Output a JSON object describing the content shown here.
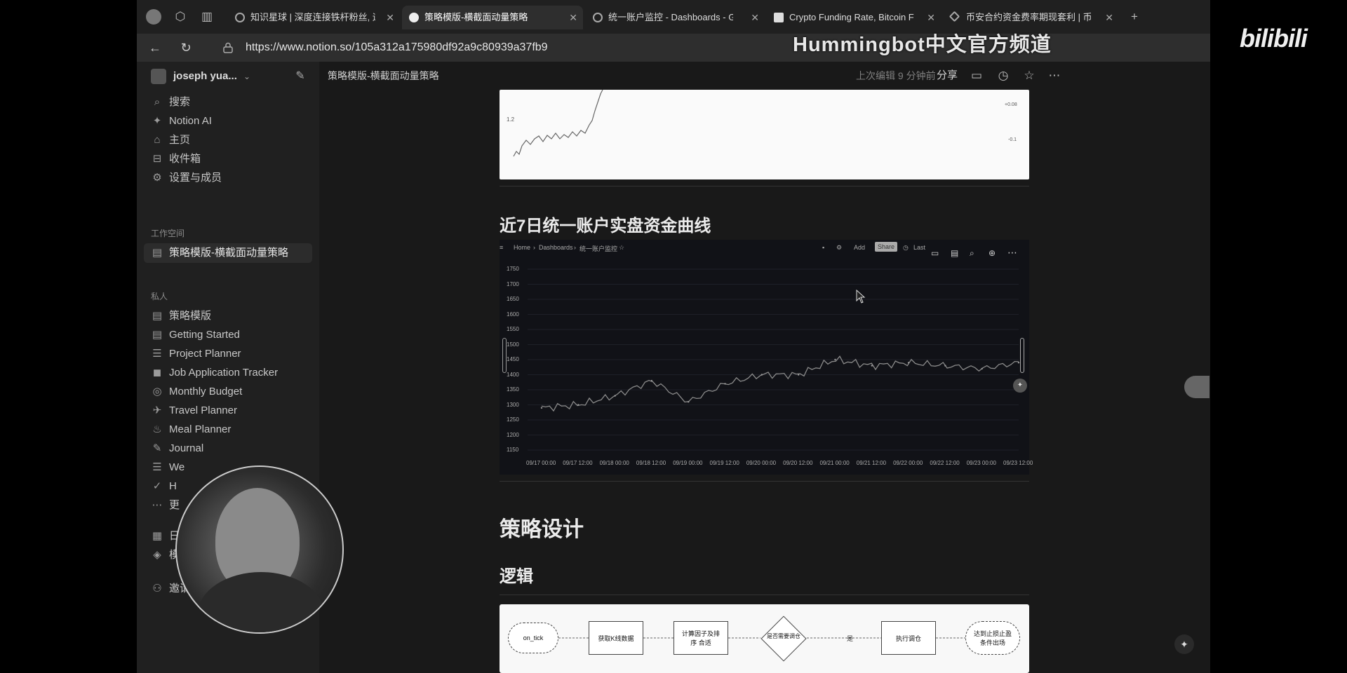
{
  "tabs": [
    {
      "title": "知识星球 | 深度连接铁杆粉丝, 运",
      "active": false
    },
    {
      "title": "策略模版-横截面动量策略",
      "active": true
    },
    {
      "title": "统一账户监控 - Dashboards - G",
      "active": false
    },
    {
      "title": "Crypto Funding Rate, Bitcoin F",
      "active": false
    },
    {
      "title": "币安合约资金费率期现套利 | 币安",
      "active": false
    }
  ],
  "url": "https://www.notion.so/105a312a175980df92a9c80939a37fb9",
  "watermark": "Hummingbot中文官方频道",
  "watermark_logo": "bilibili",
  "sidebar": {
    "workspace_name": "joseph yua...",
    "top_items": [
      {
        "label": "搜索",
        "icon": "search-icon"
      },
      {
        "label": "Notion AI",
        "icon": "sparkle-icon"
      },
      {
        "label": "主页",
        "icon": "home-icon"
      },
      {
        "label": "收件箱",
        "icon": "inbox-icon"
      },
      {
        "label": "设置与成员",
        "icon": "gear-icon"
      }
    ],
    "workspace_heading": "工作空间",
    "workspace_items": [
      {
        "label": "策略模版-横截面动量策略",
        "icon": "page-icon",
        "active": true
      }
    ],
    "private_heading": "私人",
    "private_items": [
      {
        "label": "策略模版",
        "icon": "page-icon"
      },
      {
        "label": "Getting Started",
        "icon": "page-icon"
      },
      {
        "label": "Project Planner",
        "icon": "checklist-icon"
      },
      {
        "label": "Job Application Tracker",
        "icon": "briefcase-icon"
      },
      {
        "label": "Monthly Budget",
        "icon": "coins-icon"
      },
      {
        "label": "Travel Planner",
        "icon": "plane-icon"
      },
      {
        "label": "Meal Planner",
        "icon": "fork-icon"
      },
      {
        "label": "Journal",
        "icon": "pencil-icon"
      },
      {
        "label": "We",
        "icon": "list-icon"
      },
      {
        "label": "H",
        "icon": "check-icon"
      },
      {
        "label": "更",
        "icon": "more-icon"
      }
    ],
    "bottom_items": [
      {
        "label": "日历",
        "icon": "calendar-icon"
      },
      {
        "label": "模板",
        "icon": "shapes-icon"
      },
      {
        "label": "邀请成员",
        "icon": "invite-icon"
      }
    ]
  },
  "header": {
    "breadcrumb": "策略模版-横截面动量策略",
    "edited": "上次编辑 9 分钟前",
    "share": "分享"
  },
  "content": {
    "heading_curve": "近7日统一账户实盘资金曲线",
    "heading_design": "策略设计",
    "heading_logic": "逻辑",
    "top_chart_labels": {
      "left": "1.2",
      "right_top": "+0.08",
      "right_mid": "-0.1"
    }
  },
  "grafana": {
    "breadcrumb": [
      "Home",
      "Dashboards",
      "统一账户监控"
    ],
    "add_label": "Add",
    "share_label": "Share",
    "time_label": "Last",
    "y_ticks": [
      "1750",
      "1700",
      "1650",
      "1600",
      "1550",
      "1500",
      "1450",
      "1400",
      "1350",
      "1300",
      "1250",
      "1200",
      "1150"
    ],
    "x_ticks": [
      "09/17 00:00",
      "09/17 12:00",
      "09/18 00:00",
      "09/18 12:00",
      "09/19 00:00",
      "09/19 12:00",
      "09/20 00:00",
      "09/20 12:00",
      "09/21 00:00",
      "09/21 12:00",
      "09/22 00:00",
      "09/22 12:00",
      "09/23 00:00",
      "09/23 12:00"
    ]
  },
  "chart_data": {
    "type": "line",
    "x": [
      "09/17 00:00",
      "09/17 12:00",
      "09/18 00:00",
      "09/18 12:00",
      "09/19 00:00",
      "09/19 12:00",
      "09/20 00:00",
      "09/20 12:00",
      "09/21 00:00",
      "09/21 12:00",
      "09/22 00:00",
      "09/22 12:00",
      "09/23 00:00",
      "09/23 12:00"
    ],
    "series": [
      {
        "values": [
          1290,
          1300,
          1330,
          1380,
          1310,
          1370,
          1400,
          1400,
          1450,
          1430,
          1440,
          1430,
          1420,
          1440
        ]
      }
    ],
    "ylim": [
      1150,
      1750
    ],
    "grid": true
  },
  "flow": {
    "nodes": [
      "on_tick",
      "获取K线数据",
      "计算因子及排序 合适",
      "是否需要调仓",
      "执行调仓",
      "达到止损止盈 条件出场"
    ],
    "edge_label": "是"
  }
}
